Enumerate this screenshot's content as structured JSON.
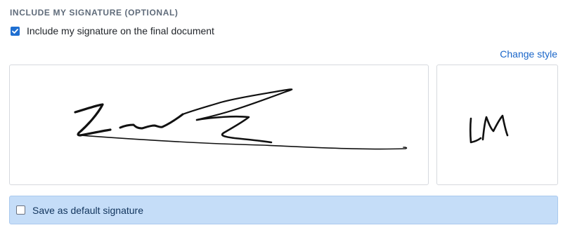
{
  "section": {
    "title": "INCLUDE MY SIGNATURE (OPTIONAL)"
  },
  "include_signature": {
    "checked": true,
    "label": "Include my signature on the final document"
  },
  "change_style_label": "Change style",
  "signature": {
    "full_name_text": "Lm",
    "initials_text": "LM"
  },
  "save_default": {
    "checked": false,
    "label": "Save as default signature"
  },
  "colors": {
    "accent": "#1f6fd1",
    "link": "#1a66c9",
    "highlight_bg": "#c5ddf8"
  },
  "icons": [
    "checkmark-icon"
  ]
}
